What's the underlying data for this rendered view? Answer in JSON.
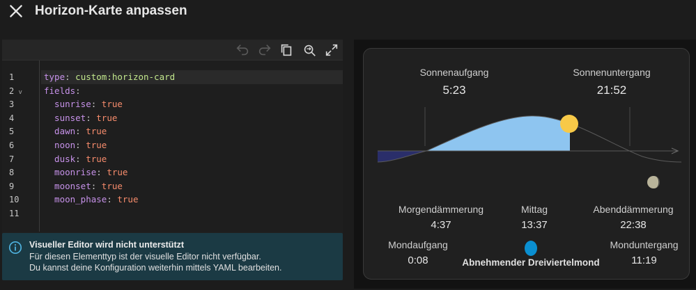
{
  "header": {
    "title": "Horizon-Karte anpassen",
    "close_icon": "close-icon"
  },
  "editor": {
    "toolbar": [
      "undo-icon",
      "redo-icon",
      "copy-icon",
      "search-replace-icon",
      "fullscreen-icon"
    ],
    "line_numbers": [
      "1",
      "2",
      "3",
      "4",
      "5",
      "6",
      "7",
      "8",
      "9",
      "10",
      "11"
    ],
    "lines": [
      {
        "key": "type",
        "sep": ": ",
        "value": "custom:horizon-card",
        "kind": "s"
      },
      {
        "key": "fields",
        "sep": ":",
        "value": "",
        "kind": ""
      },
      {
        "key": "  sunrise",
        "sep": ": ",
        "value": "true",
        "kind": "v"
      },
      {
        "key": "  sunset",
        "sep": ": ",
        "value": "true",
        "kind": "v"
      },
      {
        "key": "  dawn",
        "sep": ": ",
        "value": "true",
        "kind": "v"
      },
      {
        "key": "  noon",
        "sep": ": ",
        "value": "true",
        "kind": "v"
      },
      {
        "key": "  dusk",
        "sep": ": ",
        "value": "true",
        "kind": "v"
      },
      {
        "key": "  moonrise",
        "sep": ": ",
        "value": "true",
        "kind": "v"
      },
      {
        "key": "  moonset",
        "sep": ": ",
        "value": "true",
        "kind": "v"
      },
      {
        "key": "  moon_phase",
        "sep": ": ",
        "value": "true",
        "kind": "v"
      },
      {
        "key": "",
        "sep": "",
        "value": "",
        "kind": ""
      }
    ]
  },
  "alert": {
    "title": "Visueller Editor wird nicht unterstützt",
    "line1": "Für diesen Elementtyp ist der visuelle Editor nicht verfügbar.",
    "line2": "Du kannst deine Konfiguration weiterhin mittels YAML bearbeiten."
  },
  "preview": {
    "sunrise_label": "Sonnenaufgang",
    "sunrise_time": "5:23",
    "sunset_label": "Sonnenuntergang",
    "sunset_time": "21:52",
    "dawn_label": "Morgendämmerung",
    "dawn_time": "4:37",
    "noon_label": "Mittag",
    "noon_time": "13:37",
    "dusk_label": "Abenddämmerung",
    "dusk_time": "22:38",
    "moonrise_label": "Mondaufgang",
    "moonrise_time": "0:08",
    "moon_phase": "Abnehmender Dreiviertelmond",
    "moonset_label": "Monduntergang",
    "moonset_time": "11:19",
    "colors": {
      "sky": "#8ec5f0",
      "night": "#2a2e6a",
      "sun": "#f7c948",
      "moon": "#0a8fd1"
    }
  }
}
